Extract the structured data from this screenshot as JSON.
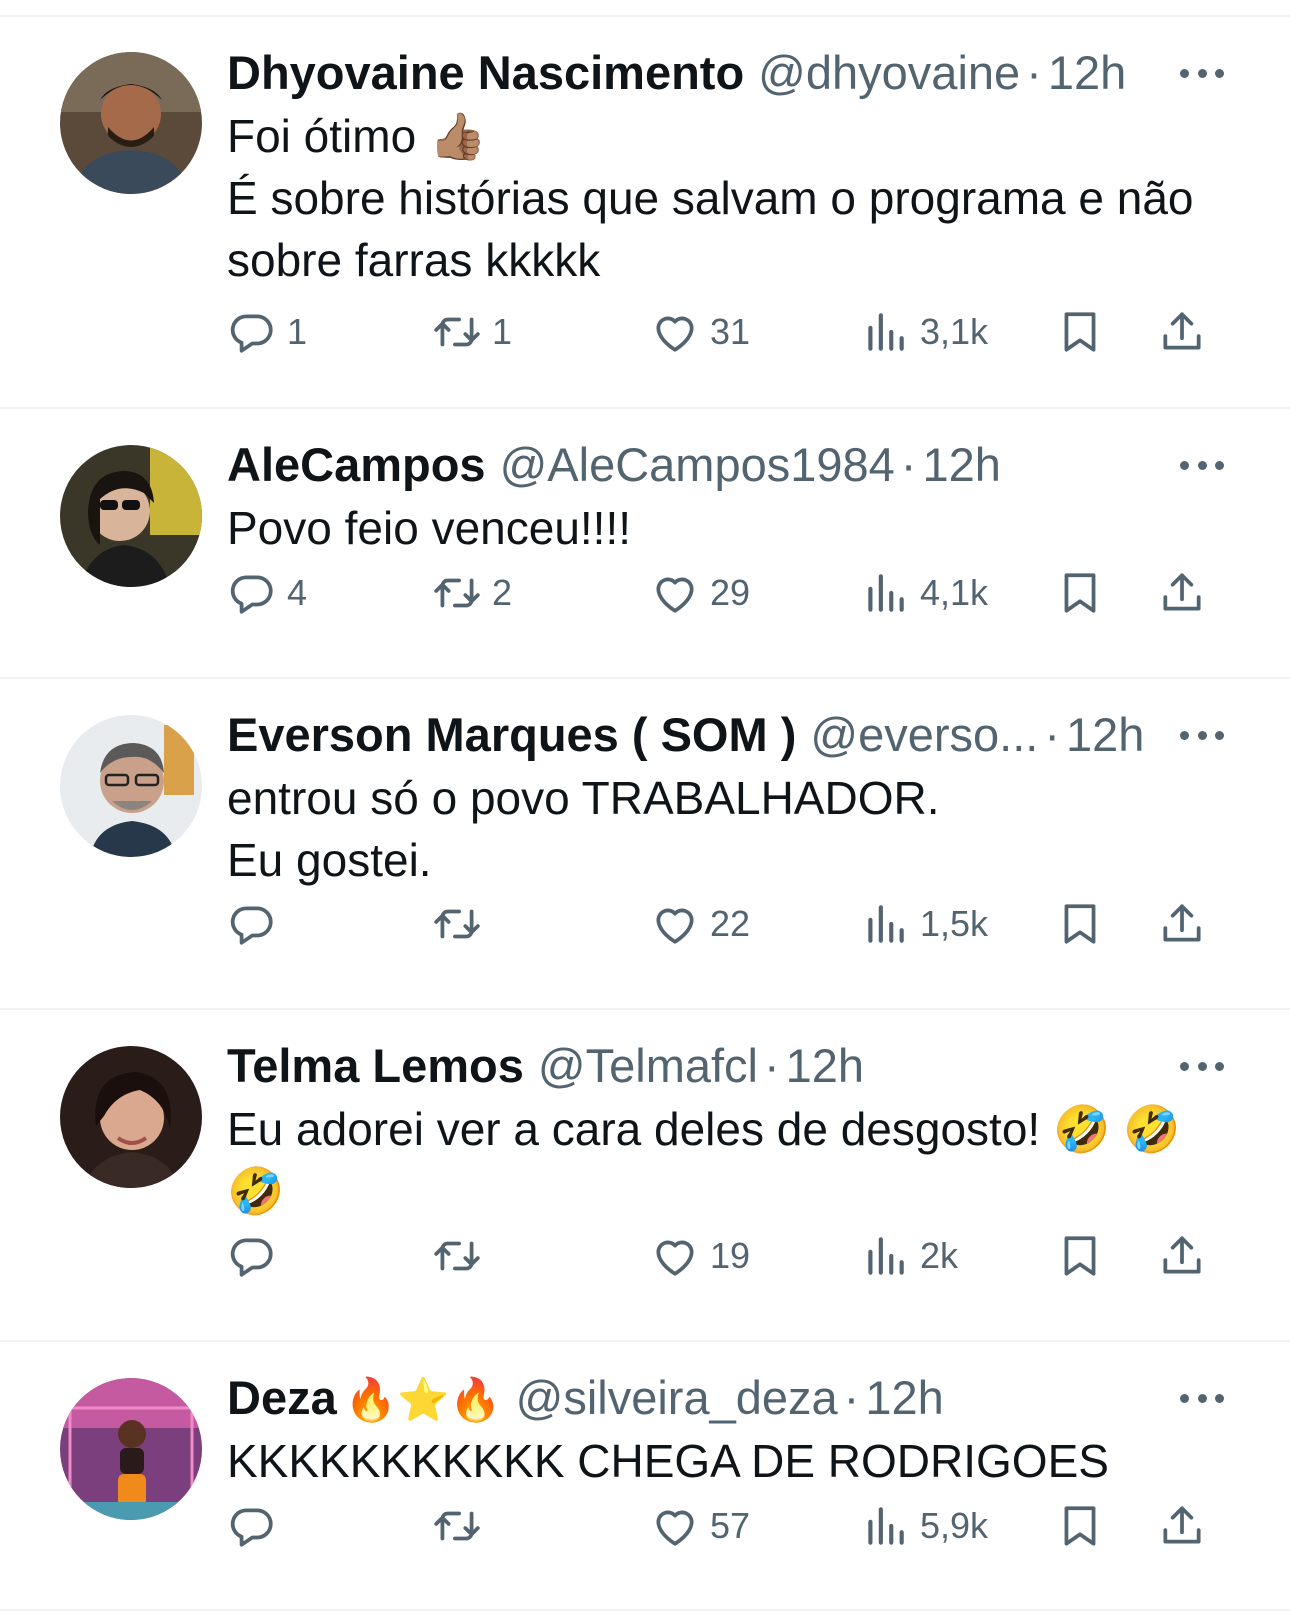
{
  "tweets": [
    {
      "name": "Dhyovaine Nascimento",
      "handle": "@dhyovaine",
      "time": "12h",
      "name_emoji": "",
      "lines": [
        "Foi ótimo 👍🏽",
        "É sobre histórias que salvam o programa e não",
        "sobre farras kkkkk"
      ],
      "replies": "1",
      "retweets": "1",
      "likes": "31",
      "views": "3,1k"
    },
    {
      "name": "AleCampos",
      "handle": "@AleCampos1984",
      "time": "12h",
      "name_emoji": "",
      "lines": [
        "Povo feio venceu!!!!"
      ],
      "replies": "4",
      "retweets": "2",
      "likes": "29",
      "views": "4,1k"
    },
    {
      "name": "Everson Marques ( SOM )",
      "handle": "@everso...",
      "time": "12h",
      "name_emoji": "",
      "lines": [
        "entrou só o povo TRABALHADOR.",
        "Eu gostei."
      ],
      "replies": "",
      "retweets": "",
      "likes": "22",
      "views": "1,5k"
    },
    {
      "name": "Telma Lemos",
      "handle": "@Telmafcl",
      "time": "12h",
      "name_emoji": "",
      "lines": [
        "Eu adorei ver a cara deles de desgosto! 🤣 🤣",
        "🤣"
      ],
      "replies": "",
      "retweets": "",
      "likes": "19",
      "views": "2k"
    },
    {
      "name": "Deza",
      "handle": "@silveira_deza",
      "time": "12h",
      "name_emoji": "🔥⭐🔥",
      "lines": [
        "KKKKKKKKKKK CHEGA DE RODRIGOES"
      ],
      "replies": "",
      "retweets": "",
      "likes": "57",
      "views": "5,9k"
    }
  ],
  "icons": {
    "reply": "reply-icon",
    "retweet": "retweet-icon",
    "like": "like-icon",
    "views": "views-icon",
    "bookmark": "bookmark-icon",
    "share": "share-icon",
    "more": "more-icon"
  },
  "colors": {
    "text": "#0f1419",
    "secondary": "#536471",
    "divider": "#eff3f4",
    "background": "#ffffff"
  },
  "separator": "·"
}
